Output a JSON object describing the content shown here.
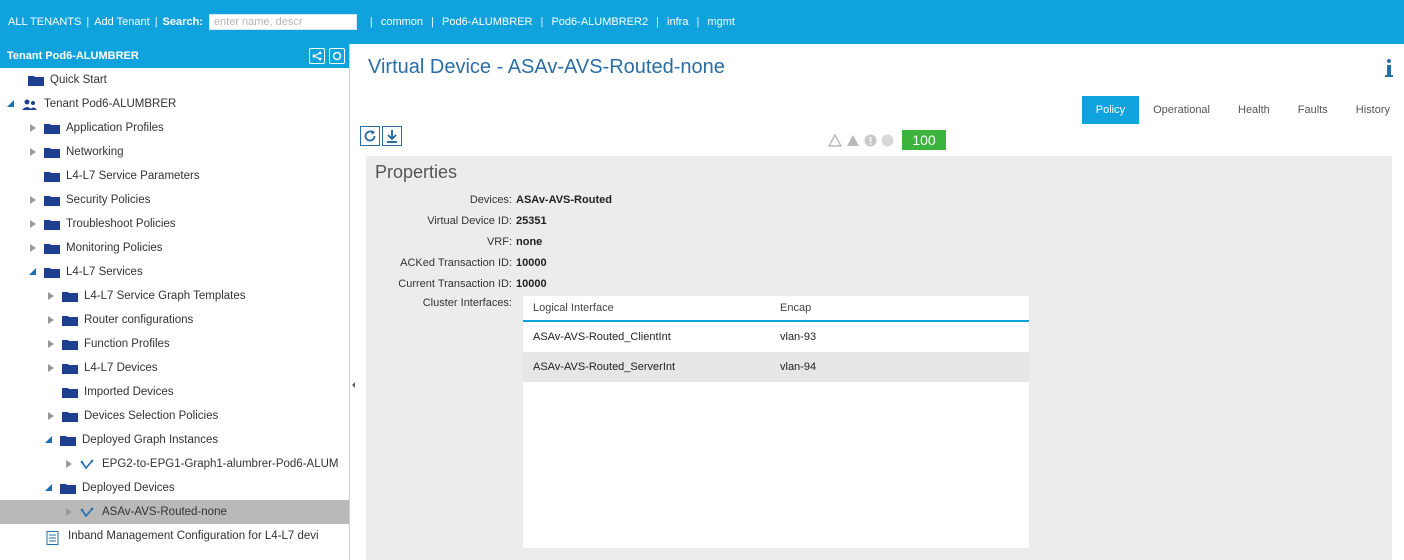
{
  "topbar": {
    "all_tenants": "ALL TENANTS",
    "add_tenant": "Add Tenant",
    "search_label": "Search:",
    "search_placeholder": "enter name, descr",
    "tenants": [
      "common",
      "Pod6-ALUMBRER",
      "Pod6-ALUMBRER2",
      "infra",
      "mgmt"
    ]
  },
  "sidebar": {
    "header_title": "Tenant Pod6-ALUMBRER",
    "items": [
      {
        "label": "Quick Start",
        "icon": "folder-icon"
      },
      {
        "label": "Tenant Pod6-ALUMBRER",
        "icon": "tenant-icon"
      },
      {
        "label": "Application Profiles",
        "icon": "folder-icon"
      },
      {
        "label": "Networking",
        "icon": "folder-icon"
      },
      {
        "label": "L4-L7 Service Parameters",
        "icon": "folder-icon"
      },
      {
        "label": "Security Policies",
        "icon": "folder-icon"
      },
      {
        "label": "Troubleshoot Policies",
        "icon": "folder-icon"
      },
      {
        "label": "Monitoring Policies",
        "icon": "folder-icon"
      },
      {
        "label": "L4-L7 Services",
        "icon": "folder-icon"
      },
      {
        "label": "L4-L7 Service Graph Templates",
        "icon": "folder-icon"
      },
      {
        "label": "Router configurations",
        "icon": "folder-icon"
      },
      {
        "label": "Function Profiles",
        "icon": "folder-icon"
      },
      {
        "label": "L4-L7 Devices",
        "icon": "folder-icon"
      },
      {
        "label": "Imported Devices",
        "icon": "folder-icon"
      },
      {
        "label": "Devices Selection Policies",
        "icon": "folder-icon"
      },
      {
        "label": "Deployed Graph Instances",
        "icon": "folder-icon"
      },
      {
        "label": "EPG2-to-EPG1-Graph1-alumbrer-Pod6-ALUM",
        "icon": "graph-icon"
      },
      {
        "label": "Deployed Devices",
        "icon": "folder-icon"
      },
      {
        "label": "ASAv-AVS-Routed-none",
        "icon": "graph-icon"
      },
      {
        "label": "Inband Management Configuration for L4-L7 devi",
        "icon": "document-icon"
      }
    ]
  },
  "main": {
    "title": "Virtual Device - ASAv-AVS-Routed-none",
    "tabs": [
      "Policy",
      "Operational",
      "Health",
      "Faults",
      "History"
    ],
    "active_tab": "Policy",
    "health_score": "100",
    "properties_title": "Properties",
    "properties": [
      {
        "key": "Devices:",
        "value": "ASAv-AVS-Routed"
      },
      {
        "key": "Virtual Device ID:",
        "value": "25351"
      },
      {
        "key": "VRF:",
        "value": "none"
      },
      {
        "key": "ACKed Transaction ID:",
        "value": "10000"
      },
      {
        "key": "Current Transaction ID:",
        "value": "10000"
      }
    ],
    "cluster_label": "Cluster Interfaces:",
    "cluster_table": {
      "headers": [
        "Logical Interface",
        "Encap"
      ],
      "rows": [
        [
          "ASAv-AVS-Routed_ClientInt",
          "vlan-93"
        ],
        [
          "ASAv-AVS-Routed_ServerInt",
          "vlan-94"
        ]
      ]
    }
  },
  "colors": {
    "accent": "#0fa2dc",
    "title_blue": "#2a6ea6",
    "folder_navy": "#1f3f8f",
    "health_green": "#3cb43c"
  }
}
